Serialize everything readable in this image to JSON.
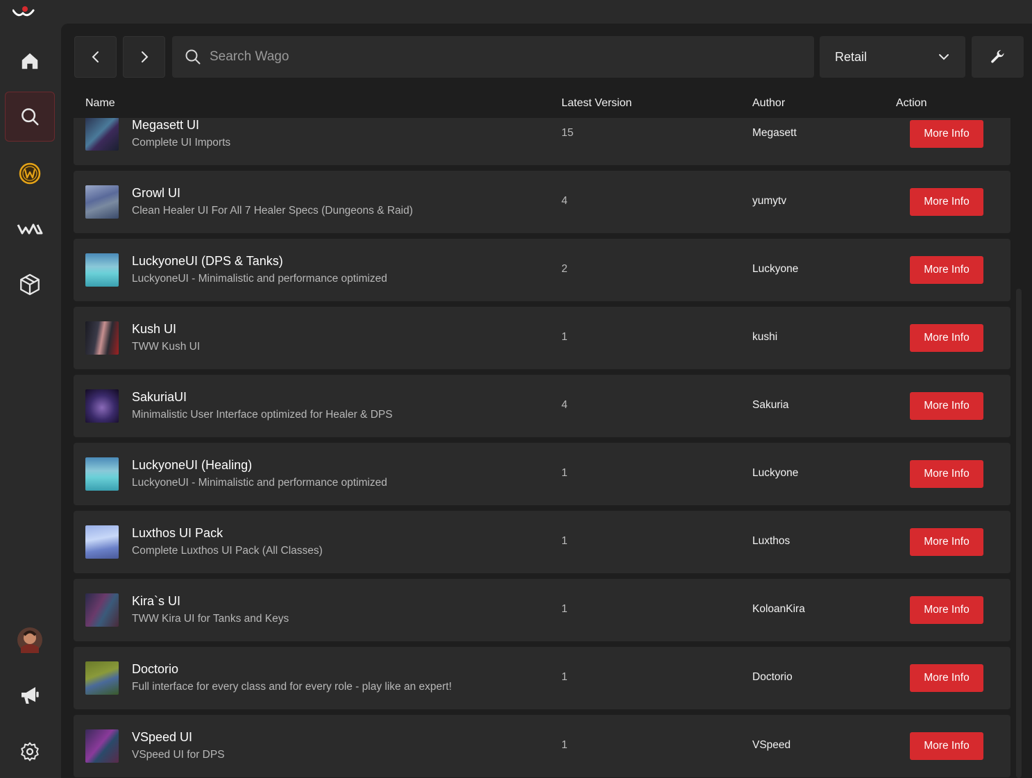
{
  "toolbar": {
    "search_placeholder": "Search Wago",
    "game_version": "Retail"
  },
  "table": {
    "col_name": "Name",
    "col_version": "Latest Version",
    "col_author": "Author",
    "col_action": "Action"
  },
  "rows": [
    {
      "title": "Megasett UI",
      "desc": "Complete UI Imports",
      "version": "15",
      "author": "Megasett",
      "action": "More Info"
    },
    {
      "title": "Growl UI",
      "desc": "Clean Healer UI For All 7 Healer Specs (Dungeons & Raid)",
      "version": "4",
      "author": "yumytv",
      "action": "More Info"
    },
    {
      "title": "LuckyoneUI (DPS & Tanks)",
      "desc": "LuckyoneUI - Minimalistic and performance optimized",
      "version": "2",
      "author": "Luckyone",
      "action": "More Info"
    },
    {
      "title": "Kush UI",
      "desc": "TWW Kush UI",
      "version": "1",
      "author": "kushi",
      "action": "More Info"
    },
    {
      "title": "SakuriaUI",
      "desc": "Minimalistic User Interface optimized for Healer & DPS",
      "version": "4",
      "author": "Sakuria",
      "action": "More Info"
    },
    {
      "title": "LuckyoneUI (Healing)",
      "desc": "LuckyoneUI - Minimalistic and performance optimized",
      "version": "1",
      "author": "Luckyone",
      "action": "More Info"
    },
    {
      "title": "Luxthos UI Pack",
      "desc": "Complete Luxthos UI Pack (All Classes)",
      "version": "1",
      "author": "Luxthos",
      "action": "More Info"
    },
    {
      "title": "Kira`s UI",
      "desc": "TWW Kira UI for Tanks and Keys",
      "version": "1",
      "author": "KoloanKira",
      "action": "More Info"
    },
    {
      "title": "Doctorio",
      "desc": "Full interface for every class and for every role - play like an expert!",
      "version": "1",
      "author": "Doctorio",
      "action": "More Info"
    },
    {
      "title": "VSpeed UI",
      "desc": "VSpeed UI for DPS",
      "version": "1",
      "author": "VSpeed",
      "action": "More Info"
    }
  ],
  "colors": {
    "accent": "#d62a2e",
    "panel": "#1e1e1e",
    "row": "#2b2b2b",
    "wow_gold": "#e6a417"
  }
}
